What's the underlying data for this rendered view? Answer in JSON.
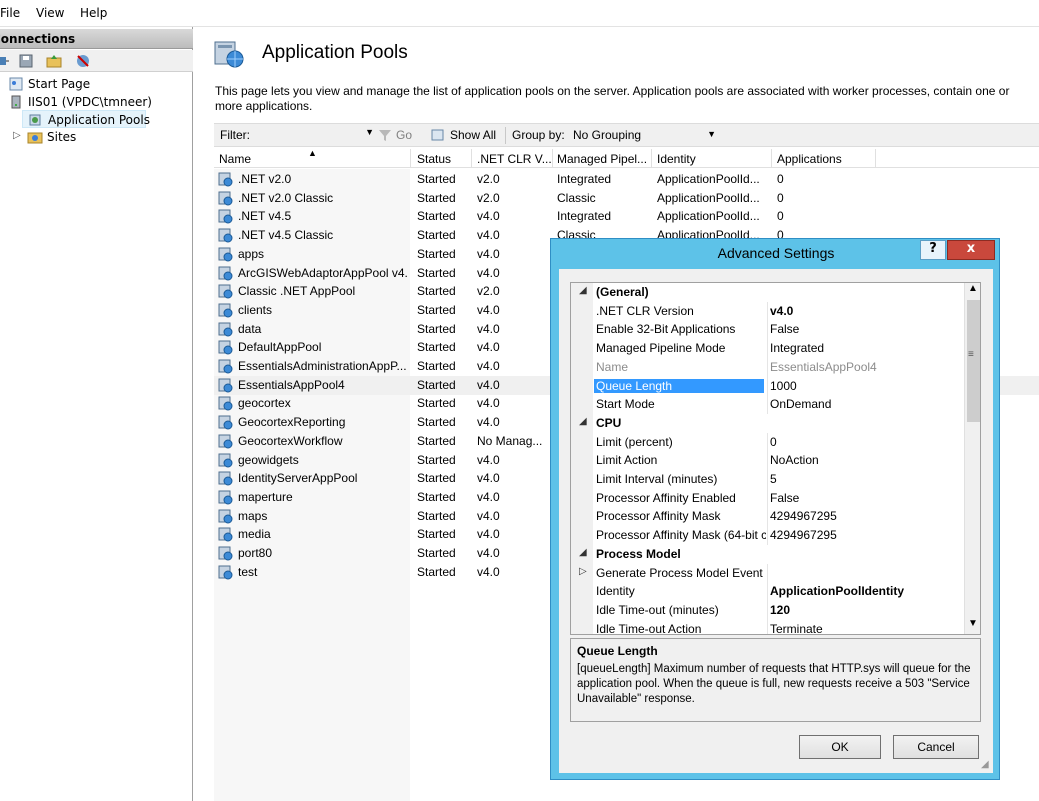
{
  "menu": [
    "File",
    "View",
    "Help"
  ],
  "connections": {
    "header": "Connections",
    "tree": {
      "start_page": "Start Page",
      "server": "IIS01 (VPDC\\tmneer)",
      "app_pools": "Application Pools",
      "sites": "Sites"
    }
  },
  "page": {
    "title": "Application Pools",
    "description": "This page lets you view and manage the list of application pools on the server. Application pools are associated with worker processes, contain one or more applications."
  },
  "filter": {
    "label": "Filter:",
    "go": "Go",
    "show_all": "Show All",
    "group_by_label": "Group by:",
    "group_by_value": "No Grouping"
  },
  "grid": {
    "columns": [
      "Name",
      "Status",
      ".NET CLR V...",
      "Managed Pipel...",
      "Identity",
      "Applications"
    ],
    "rows": [
      [
        ".NET v2.0",
        "Started",
        "v2.0",
        "Integrated",
        "ApplicationPoolId...",
        "0"
      ],
      [
        ".NET v2.0 Classic",
        "Started",
        "v2.0",
        "Classic",
        "ApplicationPoolId...",
        "0"
      ],
      [
        ".NET v4.5",
        "Started",
        "v4.0",
        "Integrated",
        "ApplicationPoolId...",
        "0"
      ],
      [
        ".NET v4.5 Classic",
        "Started",
        "v4.0",
        "Classic",
        "ApplicationPoolId...",
        "0"
      ],
      [
        "apps",
        "Started",
        "v4.0",
        "",
        "",
        ""
      ],
      [
        "ArcGISWebAdaptorAppPool v4.0",
        "Started",
        "v4.0",
        "",
        "",
        ""
      ],
      [
        "Classic .NET AppPool",
        "Started",
        "v2.0",
        "",
        "",
        ""
      ],
      [
        "clients",
        "Started",
        "v4.0",
        "",
        "",
        ""
      ],
      [
        "data",
        "Started",
        "v4.0",
        "",
        "",
        ""
      ],
      [
        "DefaultAppPool",
        "Started",
        "v4.0",
        "",
        "",
        ""
      ],
      [
        "EssentialsAdministrationAppP...",
        "Started",
        "v4.0",
        "",
        "",
        ""
      ],
      [
        "EssentialsAppPool4",
        "Started",
        "v4.0",
        "",
        "",
        ""
      ],
      [
        "geocortex",
        "Started",
        "v4.0",
        "",
        "",
        ""
      ],
      [
        "GeocortexReporting",
        "Started",
        "v4.0",
        "",
        "",
        ""
      ],
      [
        "GeocortexWorkflow",
        "Started",
        "No Manag...",
        "",
        "",
        ""
      ],
      [
        "geowidgets",
        "Started",
        "v4.0",
        "",
        "",
        ""
      ],
      [
        "IdentityServerAppPool",
        "Started",
        "v4.0",
        "",
        "",
        ""
      ],
      [
        "maperture",
        "Started",
        "v4.0",
        "",
        "",
        ""
      ],
      [
        "maps",
        "Started",
        "v4.0",
        "",
        "",
        ""
      ],
      [
        "media",
        "Started",
        "v4.0",
        "",
        "",
        ""
      ],
      [
        "port80",
        "Started",
        "v4.0",
        "",
        "",
        ""
      ],
      [
        "test",
        "Started",
        "v4.0",
        "",
        "",
        ""
      ]
    ],
    "selected_row": 11
  },
  "dialog": {
    "title": "Advanced Settings",
    "help": "?",
    "close": "x",
    "properties": [
      {
        "type": "cat",
        "expander": "◢",
        "name": "(General)"
      },
      {
        "type": "prop",
        "name": ".NET CLR Version",
        "value": "v4.0",
        "bold": true
      },
      {
        "type": "prop",
        "name": "Enable 32-Bit Applications",
        "value": "False"
      },
      {
        "type": "prop",
        "name": "Managed Pipeline Mode",
        "value": "Integrated"
      },
      {
        "type": "prop",
        "name": "Name",
        "value": "EssentialsAppPool4",
        "gray": true
      },
      {
        "type": "prop",
        "name": "Queue Length",
        "value": "1000",
        "selected": true
      },
      {
        "type": "prop",
        "name": "Start Mode",
        "value": "OnDemand"
      },
      {
        "type": "cat",
        "expander": "◢",
        "name": "CPU"
      },
      {
        "type": "prop",
        "name": "Limit (percent)",
        "value": "0"
      },
      {
        "type": "prop",
        "name": "Limit Action",
        "value": "NoAction"
      },
      {
        "type": "prop",
        "name": "Limit Interval (minutes)",
        "value": "5"
      },
      {
        "type": "prop",
        "name": "Processor Affinity Enabled",
        "value": "False"
      },
      {
        "type": "prop",
        "name": "Processor Affinity Mask",
        "value": "4294967295"
      },
      {
        "type": "prop",
        "name": "Processor Affinity Mask (64-bit c",
        "value": "4294967295"
      },
      {
        "type": "cat",
        "expander": "◢",
        "name": "Process Model"
      },
      {
        "type": "prop",
        "expander": "▷",
        "name": "Generate Process Model Event L",
        "value": ""
      },
      {
        "type": "prop",
        "name": "Identity",
        "value": "ApplicationPoolIdentity",
        "bold": true
      },
      {
        "type": "prop",
        "name": "Idle Time-out (minutes)",
        "value": "120",
        "bold": true
      },
      {
        "type": "prop",
        "name": "Idle Time-out Action",
        "value": "Terminate"
      }
    ],
    "description": {
      "title": "Queue Length",
      "text": "[queueLength] Maximum number of requests that HTTP.sys will queue for the application pool. When the queue is full, new requests receive a 503 \"Service Unavailable\" response."
    },
    "ok": "OK",
    "cancel": "Cancel"
  },
  "colors": {
    "dialog_frame": "#5dc2e8",
    "selection": "#3399ff",
    "close_button": "#c9483c"
  }
}
